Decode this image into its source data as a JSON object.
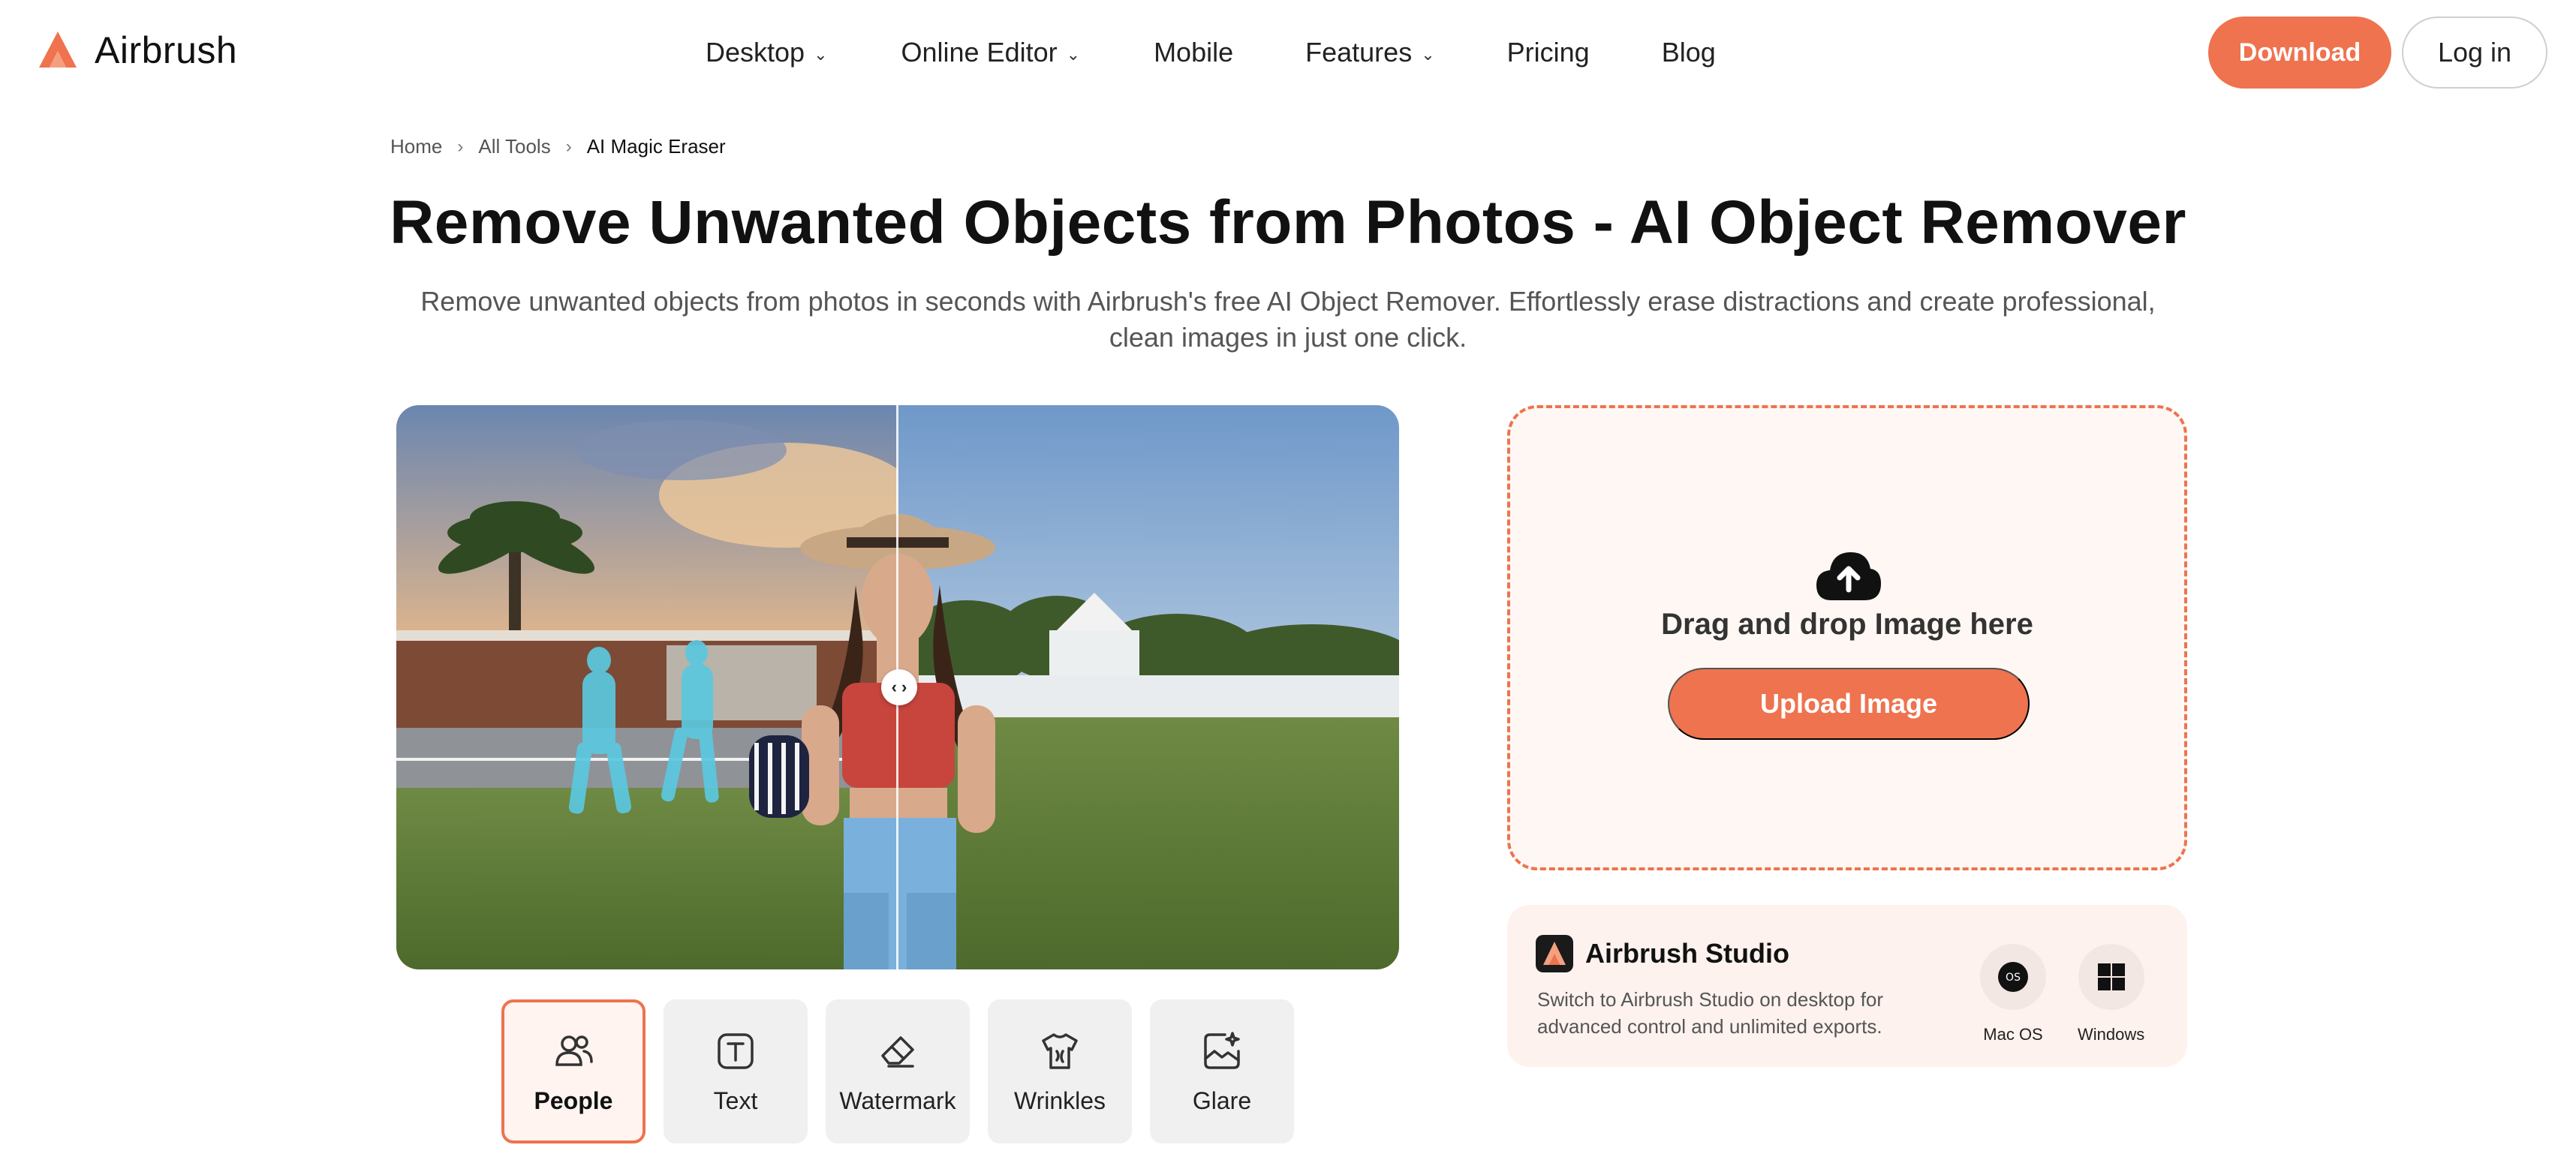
{
  "brand": {
    "name": "Airbrush",
    "accent": "#ee734e"
  },
  "nav": {
    "desktop": "Desktop",
    "online_editor": "Online Editor",
    "mobile": "Mobile",
    "features": "Features",
    "pricing": "Pricing",
    "blog": "Blog",
    "chevron": "⌄"
  },
  "header": {
    "download": "Download",
    "login": "Log in"
  },
  "breadcrumb": {
    "home": "Home",
    "all_tools": "All Tools",
    "current": "AI Magic Eraser",
    "separator": "›"
  },
  "hero": {
    "title": "Remove Unwanted Objects from Photos - AI Object Remover",
    "subtitle": "Remove unwanted objects from photos in seconds with Airbrush's free AI Object Remover. Effortlessly erase distractions and create professional, clean images in just one click."
  },
  "preview": {
    "handle": "‹ ›",
    "highlight_color": "#5bc8e0"
  },
  "tools": [
    {
      "label": "People",
      "icon": "people-icon",
      "active": true
    },
    {
      "label": "Text",
      "icon": "text-icon",
      "active": false
    },
    {
      "label": "Watermark",
      "icon": "eraser-icon",
      "active": false
    },
    {
      "label": "Wrinkles",
      "icon": "shirt-icon",
      "active": false
    },
    {
      "label": "Glare",
      "icon": "sparkle-image-icon",
      "active": false
    }
  ],
  "upload": {
    "drag_text": "Drag and drop Image here",
    "button": "Upload Image"
  },
  "studio": {
    "title": "Airbrush Studio",
    "description": "Switch to Airbrush Studio on desktop for advanced control and unlimited exports.",
    "mac": "Mac OS",
    "windows": "Windows"
  }
}
